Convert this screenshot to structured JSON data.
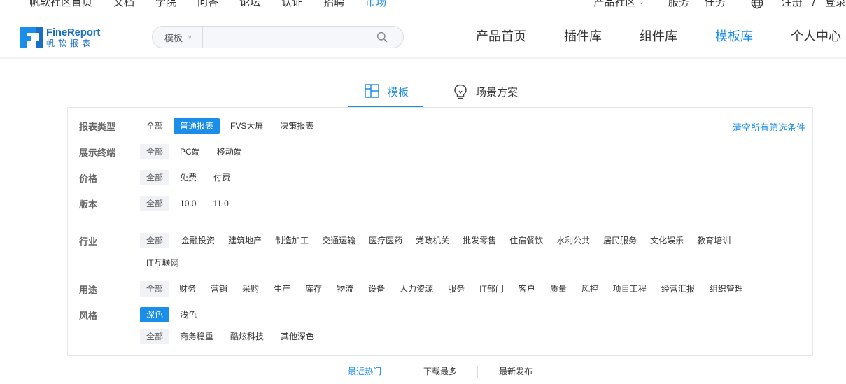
{
  "topbar": {
    "left_links": [
      "帆软社区首页",
      "文档",
      "学院",
      "问答",
      "论坛",
      "认证",
      "招聘",
      "市场"
    ],
    "active_index": 7,
    "right_links": {
      "community": "产品社区",
      "service": "服务",
      "task": "任务",
      "register": "注册",
      "divider": "/",
      "login": "登录"
    }
  },
  "logo": {
    "en": "FineReport",
    "cn": "帆软报表"
  },
  "search": {
    "scope": "模板",
    "placeholder": ""
  },
  "nav": {
    "items": [
      "产品首页",
      "插件库",
      "组件库",
      "模板库",
      "个人中心"
    ],
    "active_index": 3
  },
  "tabs": {
    "template": "模板",
    "scene": "场景方案"
  },
  "filters": {
    "clear_all": "清空所有筛选条件",
    "report_type": {
      "label": "报表类型",
      "options": [
        "全部",
        "普通报表",
        "FVS大屏",
        "决策报表"
      ],
      "selected": 1
    },
    "terminal": {
      "label": "展示终端",
      "options": [
        "全部",
        "PC端",
        "移动端"
      ],
      "selected": 0
    },
    "price": {
      "label": "价格",
      "options": [
        "全部",
        "免费",
        "付费"
      ],
      "selected": 0
    },
    "version": {
      "label": "版本",
      "options": [
        "全部",
        "10.0",
        "11.0"
      ],
      "selected": 0
    },
    "industry": {
      "label": "行业",
      "options": [
        "全部",
        "金融投资",
        "建筑地产",
        "制造加工",
        "交通运输",
        "医疗医药",
        "党政机关",
        "批发零售",
        "住宿餐饮",
        "水利公共",
        "居民服务",
        "文化娱乐",
        "教育培训"
      ],
      "options_row2": [
        "IT互联网"
      ],
      "selected": 0
    },
    "usage": {
      "label": "用途",
      "options": [
        "全部",
        "财务",
        "营销",
        "采购",
        "生产",
        "库存",
        "物流",
        "设备",
        "人力资源",
        "服务",
        "IT部门",
        "客户",
        "质量",
        "风控",
        "项目工程",
        "经营汇报",
        "组织管理"
      ],
      "selected": 0
    },
    "style": {
      "label": "风格",
      "options": [
        "深色",
        "浅色"
      ],
      "selected": 0,
      "sub_options": [
        "全部",
        "商务稳重",
        "酷炫科技",
        "其他深色"
      ],
      "sub_selected": 0
    }
  },
  "sort": {
    "items": [
      "最近热门",
      "下载最多",
      "最新发布"
    ],
    "active_index": 0
  },
  "colors": {
    "accent": "#1a8ee8",
    "logo": "#1a6ec4",
    "chip_bg": "#f0f2f5",
    "border": "#e4e7ec"
  }
}
